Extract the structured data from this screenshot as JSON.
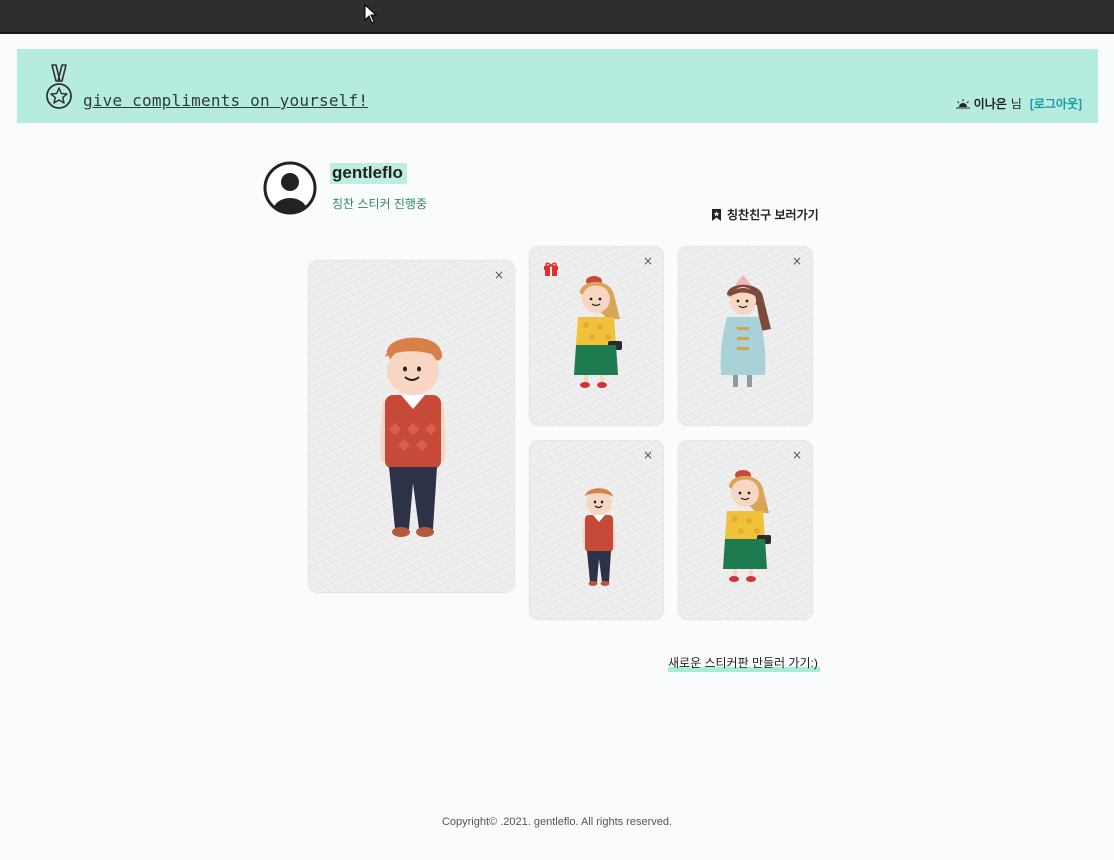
{
  "header": {
    "brand": "give compliments on yourself!",
    "user_name": "이나은",
    "user_suffix": "님",
    "logout": "[로그아웃]"
  },
  "profile": {
    "username": "gentleflo",
    "status": "칭찬 스티커 진행중",
    "friends_link": "칭찬친구 보러가기"
  },
  "stickers": [
    {
      "character": "boy-red-vest",
      "close": "×",
      "gift": false
    },
    {
      "character": "girl-yellow-top",
      "close": "×",
      "gift": true
    },
    {
      "character": "girl-blue-coat",
      "close": "×",
      "gift": false
    },
    {
      "character": "boy-red-vest",
      "close": "×",
      "gift": false
    },
    {
      "character": "girl-yellow-top",
      "close": "×",
      "gift": false
    }
  ],
  "new_board": "새로운 스티커판 만들러 가기:)",
  "footer": "Copyright© .2021. gentleflo. All rights reserved.",
  "colors": {
    "header_bg": "#b6ece0",
    "highlight": "#bdeede",
    "status_green": "#2e8b5a",
    "logout_teal": "#1b9aa8",
    "gift_red": "#e0302c"
  }
}
